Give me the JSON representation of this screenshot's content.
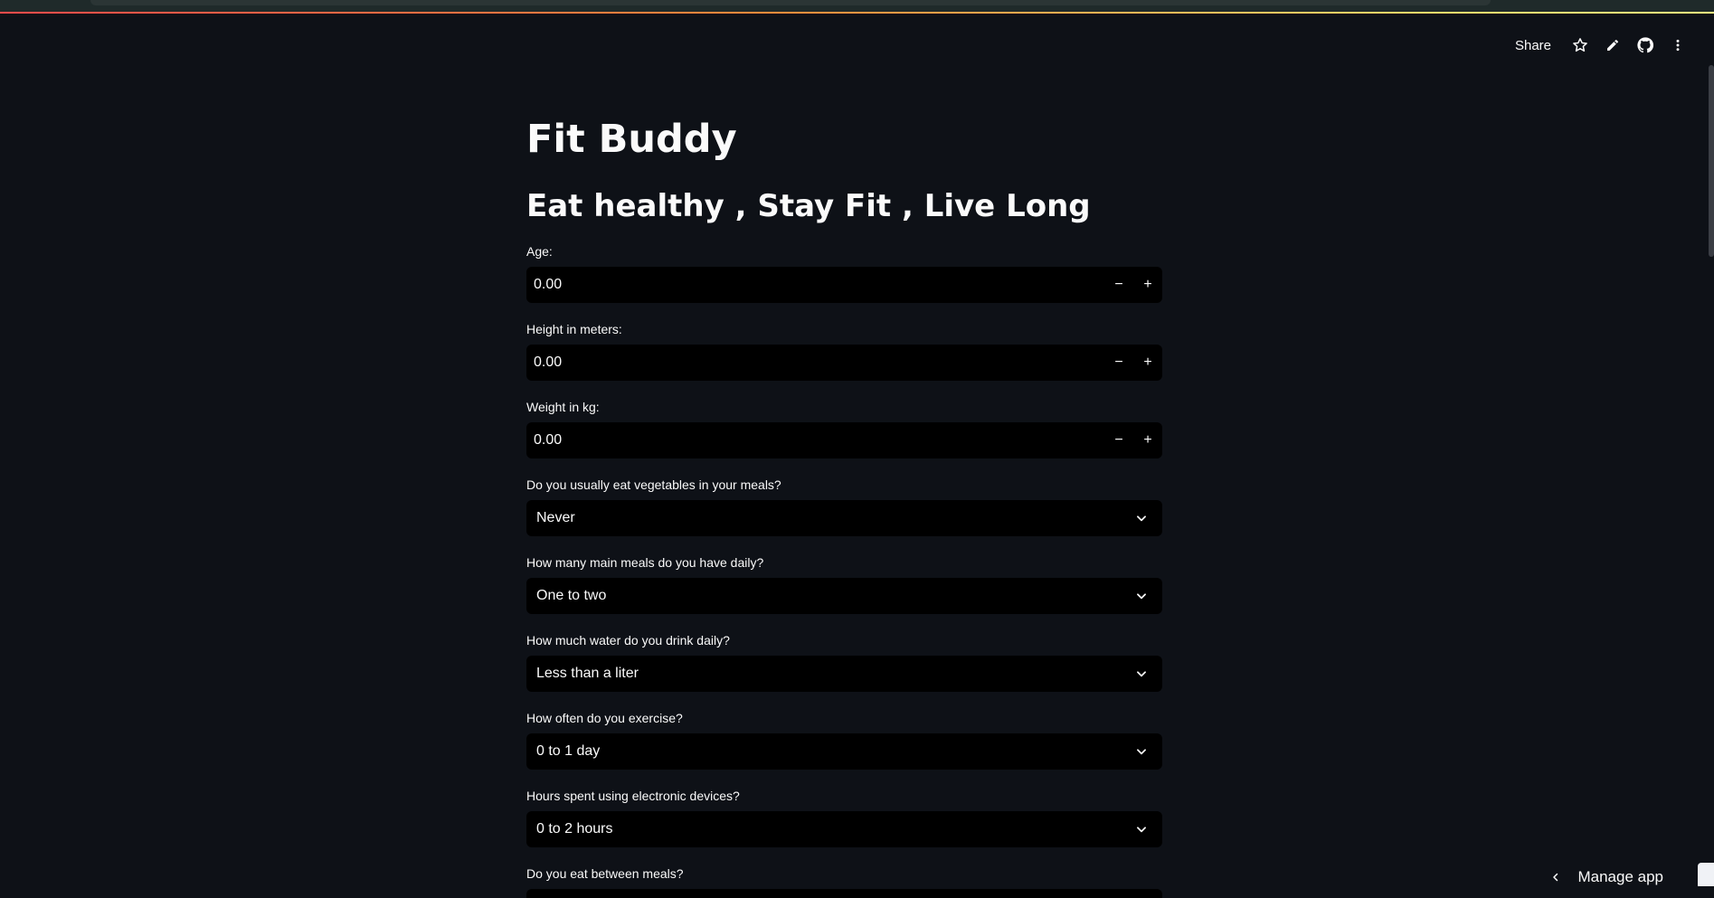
{
  "toolbar": {
    "share_label": "Share",
    "icons": [
      "star-icon",
      "edit-icon",
      "github-icon",
      "more-vertical-icon"
    ]
  },
  "app": {
    "title": "Fit Buddy",
    "subtitle": "Eat healthy , Stay Fit , Live Long"
  },
  "fields": {
    "age": {
      "label": "Age:",
      "value": "0.00"
    },
    "height": {
      "label": "Height in meters:",
      "value": "0.00"
    },
    "weight": {
      "label": "Weight in kg:",
      "value": "0.00"
    },
    "vegetables": {
      "label": "Do you usually eat vegetables in your meals?",
      "value": "Never"
    },
    "main_meals": {
      "label": "How many main meals do you have daily?",
      "value": "One to two"
    },
    "water": {
      "label": "How much water do you drink daily?",
      "value": "Less than a liter"
    },
    "exercise": {
      "label": "How often do you exercise?",
      "value": "0 to 1 day"
    },
    "devices": {
      "label": "Hours spent using electronic devices?",
      "value": "0 to 2 hours"
    },
    "between_meals": {
      "label": "Do you eat between meals?"
    }
  },
  "stepper": {
    "minus": "−",
    "plus": "+"
  },
  "footer": {
    "manage_app_label": "Manage app"
  },
  "colors": {
    "background": "#0e1117",
    "input_background": "#000000",
    "text": "#fafafa"
  }
}
